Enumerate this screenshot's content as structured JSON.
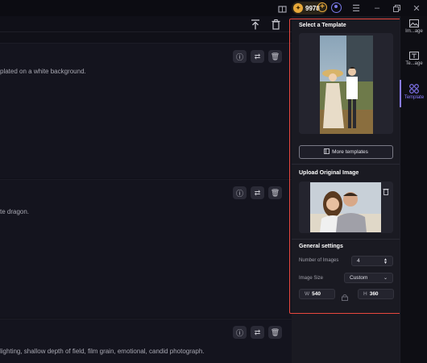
{
  "titlebar": {
    "coins": "9978",
    "icons": [
      "gift-icon",
      "coin-icon",
      "plus-icon",
      "user-icon",
      "menu-icon",
      "minimize-icon",
      "restore-icon",
      "close-icon"
    ]
  },
  "toolbar": {
    "icons": [
      "upload-icon",
      "trash-icon"
    ]
  },
  "cards": [
    {
      "prompt": "plated on a white background."
    },
    {
      "prompt": "te dragon."
    },
    {
      "prompt": "lighting, shallow depth of field, film grain, emotional, candid photograph."
    }
  ],
  "panel": {
    "select_template_title": "Select a Template",
    "more_templates_label": "More templates",
    "upload_title": "Upload Original Image",
    "general_settings_title": "General settings",
    "number_of_images_label": "Number of Images",
    "number_of_images_value": "4",
    "image_size_label": "Image Size",
    "image_size_value": "Custom",
    "width_prefix": "W",
    "width_value": "540",
    "height_prefix": "H",
    "height_value": "360"
  },
  "rail": {
    "items": [
      {
        "label": "Im...age",
        "icon": "image-icon"
      },
      {
        "label": "Te...age",
        "icon": "text-image-icon"
      },
      {
        "label": "Template",
        "icon": "template-icon",
        "active": true
      }
    ]
  },
  "colors": {
    "accent": "#8a7cff",
    "highlight_border": "#e8473e",
    "coin": "#e8a93a"
  }
}
